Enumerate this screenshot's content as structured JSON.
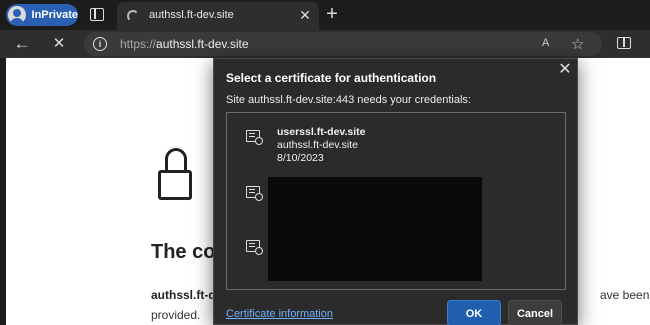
{
  "browser": {
    "profile_label": "InPrivate",
    "tab_title": "authssl.ft-dev.site",
    "tab_close": "✕",
    "new_tab": "+",
    "url_prefix": "https://",
    "url_host": "authssl.ft-dev.site",
    "read_aloud": "A",
    "favorite": "☆"
  },
  "page": {
    "heading": "The co",
    "text_bold": "authssl.ft-d",
    "text_tail": "ave been",
    "text_line2": "provided."
  },
  "dialog": {
    "title": "Select a certificate for authentication",
    "message": "Site authssl.ft-dev.site:443 needs your credentials:",
    "close": "✕",
    "certificates": [
      {
        "subject": "userssl.ft-dev.site",
        "issuer": "authssl.ft-dev.site",
        "date": "8/10/2023",
        "redacted": false
      },
      {
        "subject": "",
        "issuer": "",
        "date": "",
        "redacted": true
      },
      {
        "subject": "",
        "issuer": "",
        "date": "",
        "redacted": true
      }
    ],
    "cert_info_link": "Certificate information",
    "ok_label": "OK",
    "cancel_label": "Cancel"
  }
}
